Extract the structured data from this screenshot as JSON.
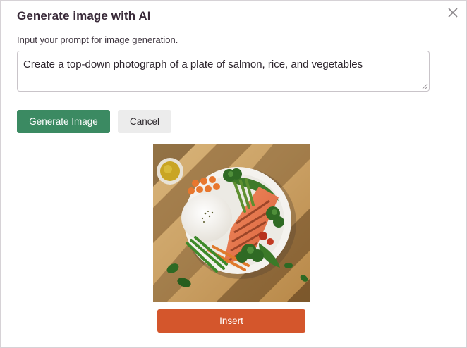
{
  "dialog": {
    "title": "Generate image with AI",
    "close_icon": "close-icon",
    "prompt_label": "Input your prompt for image generation.",
    "prompt_value": "Create a top-down photograph of a plate of salmon, rice, and vegetables",
    "generate_label": "Generate Image",
    "cancel_label": "Cancel",
    "insert_label": "Insert"
  },
  "colors": {
    "generate_button": "#3b8a62",
    "cancel_button": "#ececec",
    "insert_button": "#d4562c",
    "title_text": "#3a2b3a"
  }
}
